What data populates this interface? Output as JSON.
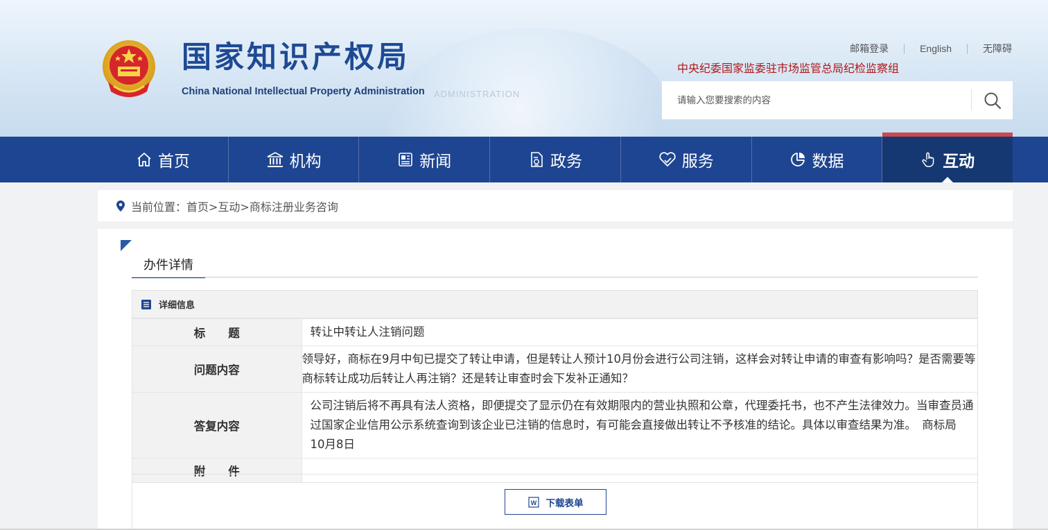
{
  "header": {
    "logo_cn": "国家知识产权局",
    "logo_en": "China National Intellectual Property Administration",
    "watermark": "ADMINISTRATION",
    "top_links": [
      "邮箱登录",
      "English",
      "无障碍"
    ],
    "discipline_text": "中央纪委国家监委驻市场监管总局纪检监察组",
    "search_placeholder": "请输入您要搜索的内容"
  },
  "nav": {
    "items": [
      {
        "label": "首页",
        "icon": "home-icon"
      },
      {
        "label": "机构",
        "icon": "institution-icon"
      },
      {
        "label": "新闻",
        "icon": "news-icon"
      },
      {
        "label": "政务",
        "icon": "document-icon"
      },
      {
        "label": "服务",
        "icon": "service-heart-icon"
      },
      {
        "label": "数据",
        "icon": "pie-chart-icon"
      },
      {
        "label": "互动",
        "icon": "hand-pointer-icon"
      }
    ],
    "active": "互动"
  },
  "breadcrumb": {
    "text": "当前位置：首页>互动>商标注册业务咨询"
  },
  "main": {
    "tab_title": "办件详情",
    "section_title": "详细信息",
    "rows": [
      {
        "label": "标　　题",
        "value": "转让中转让人注销问题"
      },
      {
        "label": "问题内容",
        "value": "领导好，商标在9月中旬已提交了转让申请，但是转让人预计10月份会进行公司注销，这样会对转让申请的审查有影响吗？是否需要等商标转让成功后转让人再注销？还是转让审查时会下发补正通知？"
      },
      {
        "label": "答复内容",
        "value": "公司注销后将不再具有法人资格，即便提交了显示仍在有效期限内的营业执照和公章，代理委托书，也不产生法律效力。当审查员通过国家企业信用公示系统查询到该企业已注销的信息时，有可能会直接做出转让不予核准的结论。具体以审查结果为准。　商标局　10月8日"
      },
      {
        "label": "附　　件",
        "value": ""
      }
    ],
    "download_label": "下载表单"
  },
  "colors": {
    "nav_bg": "#1e4591",
    "nav_active": "#163872",
    "accent_red": "#c94a50",
    "logo_blue": "#1e4a94"
  }
}
